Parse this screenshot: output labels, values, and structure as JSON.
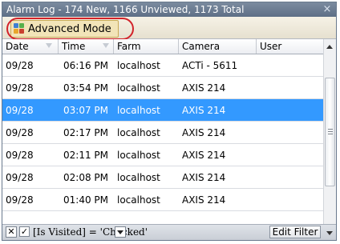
{
  "window": {
    "title": "Alarm Log - 174 New, 1166 Unviewed, 1173 Total",
    "close_glyph": "×"
  },
  "toolbar": {
    "advanced_mode_label": "Advanced Mode",
    "advanced_mode_icon": "advanced-mode-icon"
  },
  "table": {
    "columns": [
      "Date",
      "Time",
      "Farm",
      "Camera",
      "User"
    ],
    "rows": [
      {
        "date": "09/28",
        "time": "06:16 PM",
        "farm": "localhost",
        "camera": "ACTi - 5611",
        "user": "",
        "selected": false
      },
      {
        "date": "09/28",
        "time": "03:54 PM",
        "farm": "localhost",
        "camera": "AXIS 214",
        "user": "",
        "selected": false
      },
      {
        "date": "09/28",
        "time": "03:07 PM",
        "farm": "localhost",
        "camera": "AXIS 214",
        "user": "",
        "selected": true
      },
      {
        "date": "09/28",
        "time": "02:17 PM",
        "farm": "localhost",
        "camera": "AXIS 214",
        "user": "",
        "selected": false
      },
      {
        "date": "09/28",
        "time": "02:11 PM",
        "farm": "localhost",
        "camera": "AXIS 214",
        "user": "",
        "selected": false
      },
      {
        "date": "09/28",
        "time": "02:08 PM",
        "farm": "localhost",
        "camera": "AXIS 214",
        "user": "",
        "selected": false
      },
      {
        "date": "09/28",
        "time": "01:40 PM",
        "farm": "localhost",
        "camera": "AXIS 214",
        "user": "",
        "selected": false
      }
    ]
  },
  "filter": {
    "clear_glyph": "✕",
    "checkbox_glyph": "✓",
    "expression": "[Is Visited] = 'Checked'",
    "edit_filter_label": "Edit Filter"
  },
  "colors": {
    "selection": "#3399ff",
    "highlight_ring": "#d2232a",
    "titlebar": "#6b7b91"
  }
}
